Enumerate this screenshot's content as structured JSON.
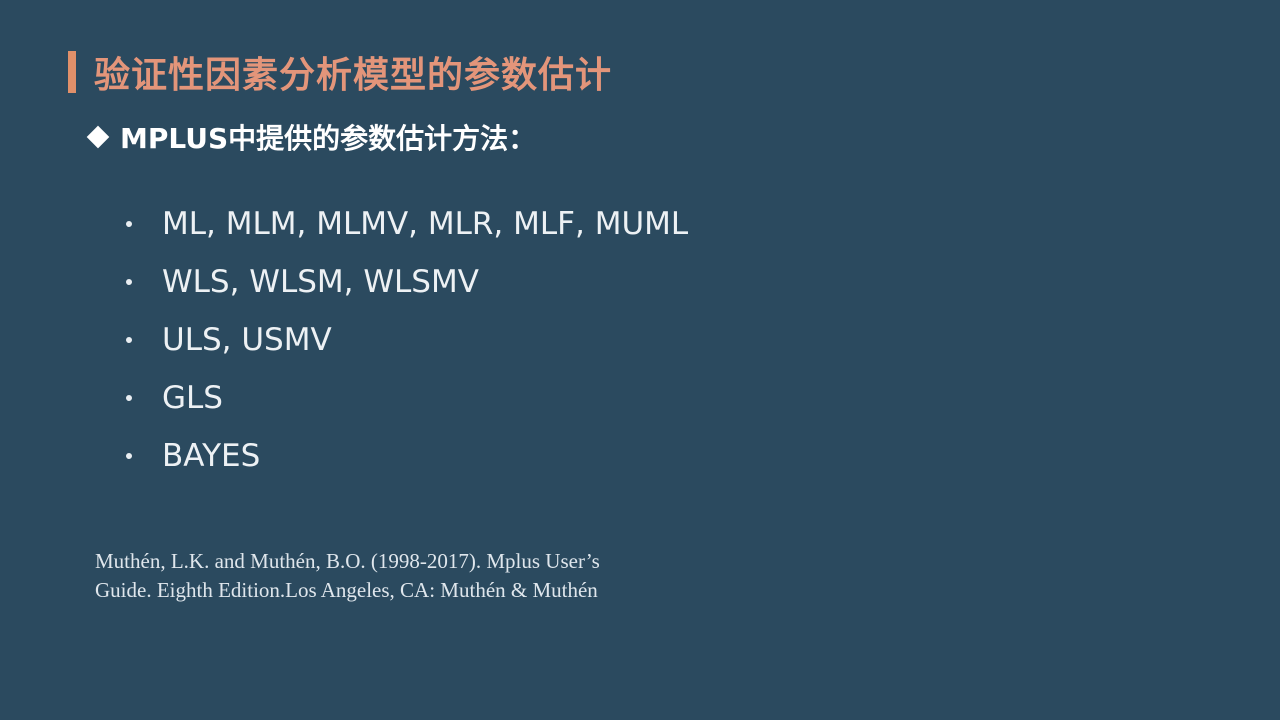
{
  "slide": {
    "title": "验证性因素分析模型的参数估计",
    "subtitle": "MPLUS中提供的参数估计方法：",
    "methods": [
      "ML, MLM, MLMV, MLR, MLF, MUML",
      "WLS, WLSM, WLSMV",
      "ULS, USMV",
      "GLS",
      "BAYES"
    ],
    "citation": {
      "line1": "Muthén, L.K. and Muthén, B.O. (1998-2017).  Mplus User’s",
      "line2": "Guide.  Eighth Edition.Los Angeles, CA: Muthén & Muthén"
    }
  },
  "colors": {
    "background": "#2b4a5f",
    "title_accent": "#e3957a",
    "text": "#edf1f4"
  },
  "icons": {
    "title_marker": "vertical-bar-icon",
    "subtitle_marker": "diamond-icon",
    "list_marker": "bullet-icon"
  }
}
